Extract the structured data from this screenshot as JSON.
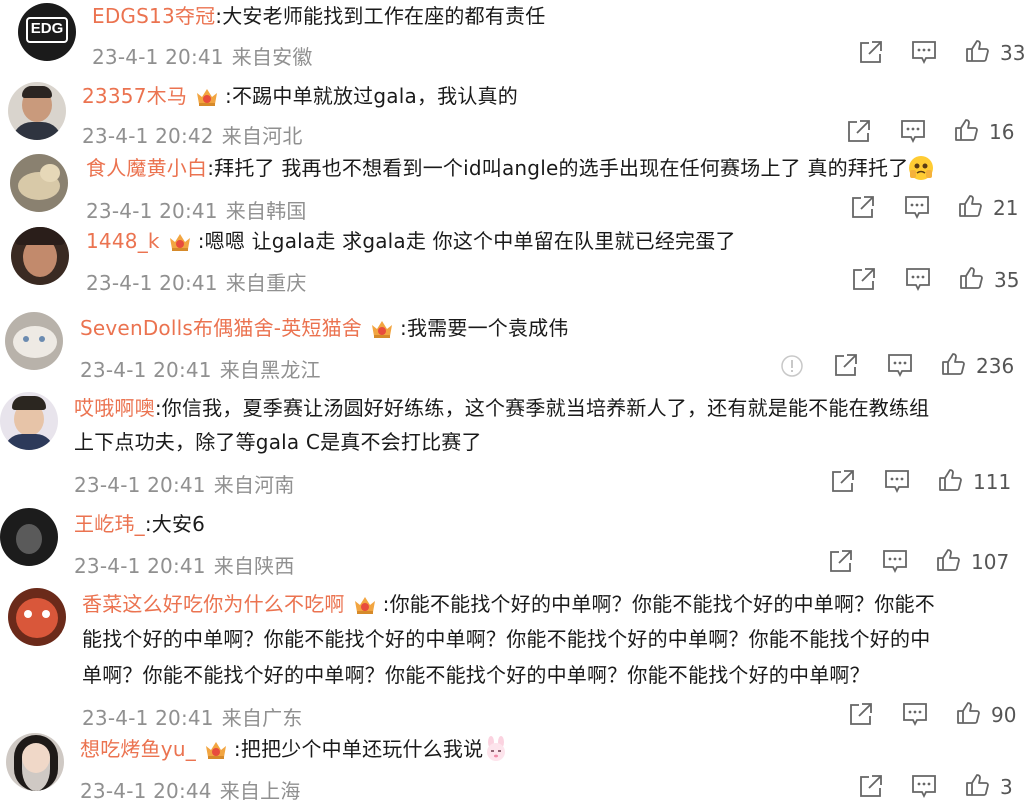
{
  "comments": [
    {
      "user": "EDGS13夺冠",
      "sep": ":",
      "text": "大安老师能找到工作在座的都有责任",
      "time": "23-4-1 20:41",
      "location": "来自安徽",
      "likes": "33",
      "avatar_logo": "EDG",
      "crown": false
    },
    {
      "user": "23357木马",
      "sep": ":",
      "text": "不踢中单就放过gala，我认真的",
      "time": "23-4-1 20:42",
      "location": "来自河北",
      "likes": "16",
      "crown": true
    },
    {
      "user": "食人魔黄小白",
      "sep": ":",
      "text": "拜托了 我再也不想看到一个id叫angle的选手出现在任何赛场上了 真的拜托了",
      "time": "23-4-1 20:41",
      "location": "来自韩国",
      "likes": "21",
      "crown": false
    },
    {
      "user": "1448_k",
      "sep": ":",
      "text": "嗯嗯 让gala走 求gala走 你这个中单留在队里就已经完蛋了",
      "time": "23-4-1 20:41",
      "location": "来自重庆",
      "likes": "35",
      "crown": true
    },
    {
      "user": "SevenDolls布偶猫舍-英短猫舍",
      "sep": ":",
      "text": "我需要一个袁成伟",
      "time": "23-4-1 20:41",
      "location": "来自黑龙江",
      "likes": "236",
      "crown": true
    },
    {
      "user": "哎哦啊噢",
      "sep": ":",
      "text": "你信我，夏季赛让汤圆好好练练，这个赛季就当培养新人了，还有就是能不能在教练组",
      "text2": "上下点功夫，除了等gala C是真不会打比赛了",
      "time": "23-4-1 20:41",
      "location": "来自河南",
      "likes": "111",
      "crown": false
    },
    {
      "user": "王屹玮_",
      "sep": ":",
      "text": "大安6",
      "time": "23-4-1 20:41",
      "location": "来自陕西",
      "likes": "107",
      "crown": false
    },
    {
      "user": "香菜这么好吃你为什么不吃啊",
      "sep": ":",
      "text": "你能不能找个好的中单啊？你能不能找个好的中单啊？你能不",
      "text2": "能找个好的中单啊？你能不能找个好的中单啊？你能不能找个好的中单啊？你能不能找个好的中",
      "text3": "单啊？你能不能找个好的中单啊？你能不能找个好的中单啊？你能不能找个好的中单啊？",
      "time": "23-4-1 20:41",
      "location": "来自广东",
      "likes": "90",
      "crown": true
    },
    {
      "user": "想吃烤鱼yu_",
      "sep": ":",
      "text": "把把少个中单还玩什么我说",
      "time": "23-4-1 20:44",
      "location": "来自上海",
      "likes": "3",
      "crown": true
    }
  ],
  "colors": {
    "username": "#eb7350",
    "meta": "#909090",
    "text": "#1a1a1a",
    "icon": "#666666"
  },
  "icons": [
    "share-icon",
    "comment-icon",
    "like-icon",
    "report-icon",
    "crown-badge-icon"
  ]
}
